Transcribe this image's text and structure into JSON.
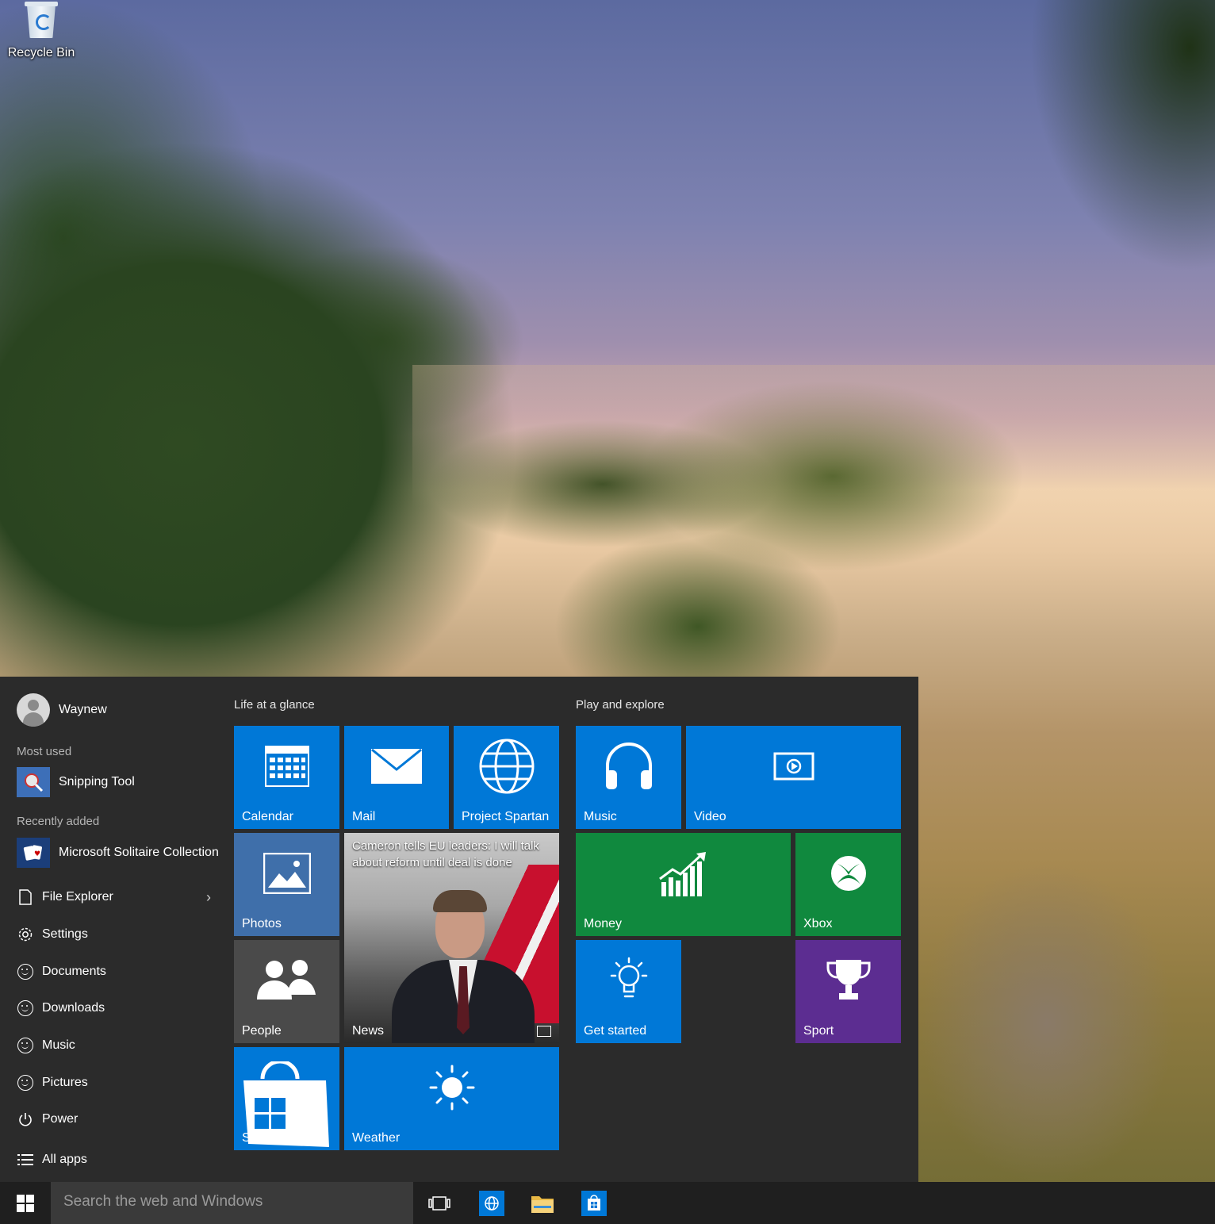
{
  "desktop": {
    "recycle_bin_label": "Recycle Bin"
  },
  "start_menu": {
    "user_name": "Waynew",
    "most_used_label": "Most used",
    "most_used": [
      {
        "label": "Snipping Tool",
        "icon": "snipping-tool-icon"
      }
    ],
    "recently_added_label": "Recently added",
    "recently_added": [
      {
        "label": "Microsoft Solitaire Collection",
        "icon": "solitaire-icon"
      }
    ],
    "places": [
      {
        "label": "File Explorer",
        "icon": "file-explorer-icon"
      },
      {
        "label": "Settings",
        "icon": "gear-icon"
      },
      {
        "label": "Documents",
        "icon": "documents-icon"
      },
      {
        "label": "Downloads",
        "icon": "downloads-icon"
      },
      {
        "label": "Music",
        "icon": "music-folder-icon"
      },
      {
        "label": "Pictures",
        "icon": "pictures-icon"
      },
      {
        "label": "Power",
        "icon": "power-icon"
      }
    ],
    "all_apps_label": "All apps",
    "groups": {
      "life_title": "Life at a glance",
      "play_title": "Play and explore"
    },
    "tiles": {
      "calendar": "Calendar",
      "mail": "Mail",
      "project_spartan": "Project Spartan",
      "photos": "Photos",
      "news": "News",
      "news_headline": "Cameron tells EU leaders: I will talk about reform until deal is done",
      "people": "People",
      "store": "Store (",
      "weather": "Weather",
      "music": "Music",
      "video": "Video",
      "money": "Money",
      "xbox": "Xbox",
      "get_started": "Get started",
      "sport": "Sport"
    }
  },
  "taskbar": {
    "search_placeholder": "Search the web and Windows"
  },
  "colors": {
    "tile_blue": "#0078d7",
    "tile_green": "#10893e",
    "tile_purple": "#5c2d91",
    "start_bg": "#2b2b2b",
    "taskbar_bg": "#1f1f1f"
  }
}
